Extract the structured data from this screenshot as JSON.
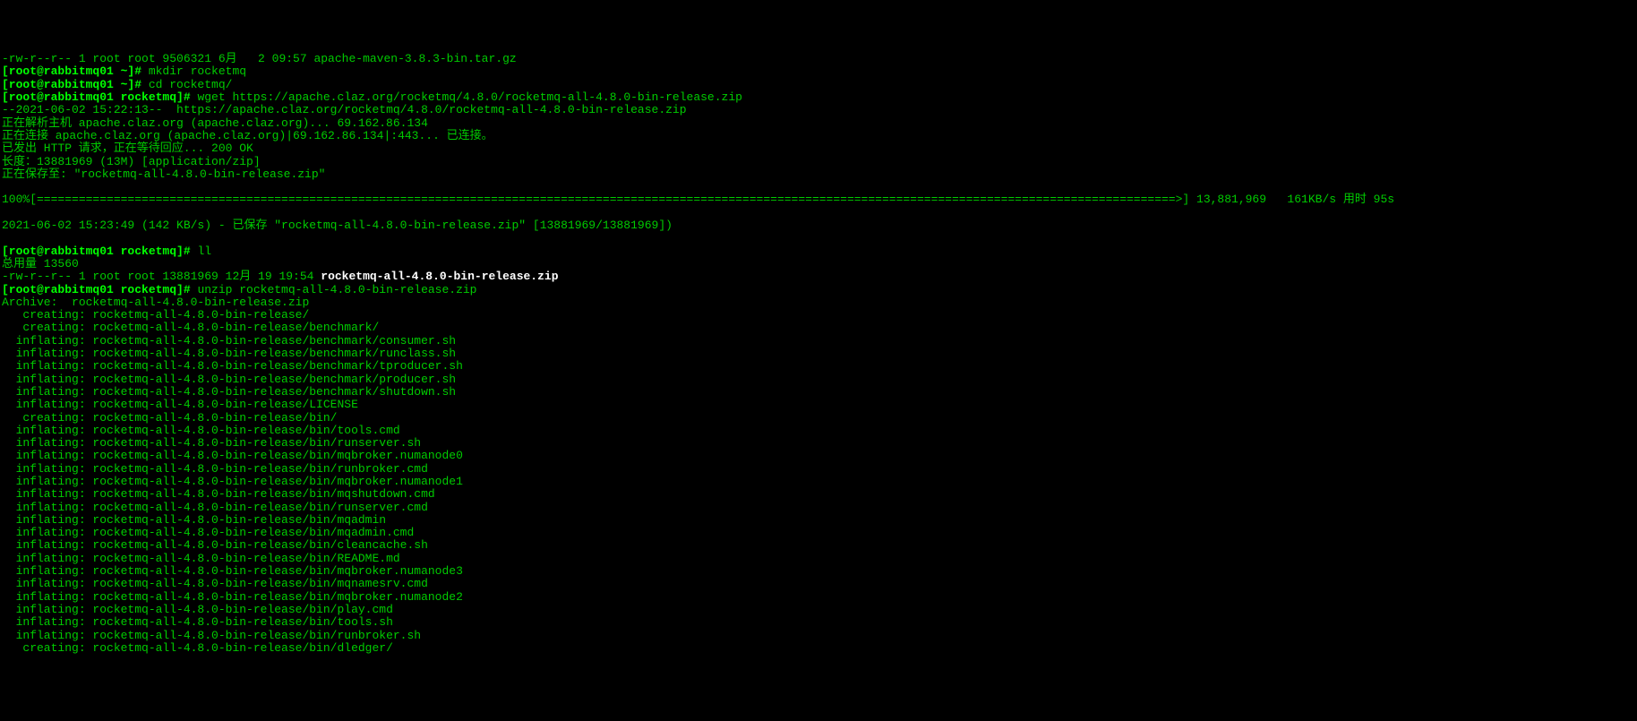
{
  "lines": [
    {
      "text": "-rw-r--r-- 1 root root 9506321 6月   2 09:57 apache-maven-3.8.3-bin.tar.gz",
      "class": "normal-green"
    },
    {
      "segments": [
        {
          "text": "[root@rabbitmq01 ~]# ",
          "class": "bright-green"
        },
        {
          "text": "mkdir rocketmq",
          "class": "normal-green"
        }
      ]
    },
    {
      "segments": [
        {
          "text": "[root@rabbitmq01 ~]# ",
          "class": "bright-green"
        },
        {
          "text": "cd rocketmq/",
          "class": "normal-green"
        }
      ]
    },
    {
      "segments": [
        {
          "text": "[root@rabbitmq01 rocketmq]# ",
          "class": "bright-green"
        },
        {
          "text": "wget https://apache.claz.org/rocketmq/4.8.0/rocketmq-all-4.8.0-bin-release.zip",
          "class": "normal-green"
        }
      ]
    },
    {
      "text": "--2021-06-02 15:22:13--  https://apache.claz.org/rocketmq/4.8.0/rocketmq-all-4.8.0-bin-release.zip",
      "class": "normal-green"
    },
    {
      "text": "正在解析主机 apache.claz.org (apache.claz.org)... 69.162.86.134",
      "class": "normal-green"
    },
    {
      "text": "正在连接 apache.claz.org (apache.claz.org)|69.162.86.134|:443... 已连接。",
      "class": "normal-green"
    },
    {
      "text": "已发出 HTTP 请求，正在等待回应... 200 OK",
      "class": "normal-green"
    },
    {
      "text": "长度：13881969 (13M) [application/zip]",
      "class": "normal-green"
    },
    {
      "text": "正在保存至: \"rocketmq-all-4.8.0-bin-release.zip\"",
      "class": "normal-green"
    },
    {
      "text": " ",
      "class": "normal-green"
    },
    {
      "text": "100%[===================================================================================================================================================================>] 13,881,969   161KB/s 用时 95s   ",
      "class": "normal-green"
    },
    {
      "text": " ",
      "class": "normal-green"
    },
    {
      "text": "2021-06-02 15:23:49 (142 KB/s) - 已保存 \"rocketmq-all-4.8.0-bin-release.zip\" [13881969/13881969])",
      "class": "normal-green"
    },
    {
      "text": " ",
      "class": "normal-green"
    },
    {
      "segments": [
        {
          "text": "[root@rabbitmq01 rocketmq]# ",
          "class": "bright-green"
        },
        {
          "text": "ll",
          "class": "normal-green"
        }
      ]
    },
    {
      "text": "总用量 13560",
      "class": "normal-green"
    },
    {
      "segments": [
        {
          "text": "-rw-r--r-- 1 root root 13881969 12月 19 19:54 ",
          "class": "normal-green"
        },
        {
          "text": "rocketmq-all-4.8.0-bin-release.zip",
          "class": "white-bold"
        }
      ]
    },
    {
      "segments": [
        {
          "text": "[root@rabbitmq01 rocketmq]# ",
          "class": "bright-green"
        },
        {
          "text": "unzip rocketmq-all-4.8.0-bin-release.zip",
          "class": "normal-green"
        }
      ]
    },
    {
      "text": "Archive:  rocketmq-all-4.8.0-bin-release.zip",
      "class": "normal-green"
    },
    {
      "text": "   creating: rocketmq-all-4.8.0-bin-release/",
      "class": "normal-green"
    },
    {
      "text": "   creating: rocketmq-all-4.8.0-bin-release/benchmark/",
      "class": "normal-green"
    },
    {
      "text": "  inflating: rocketmq-all-4.8.0-bin-release/benchmark/consumer.sh",
      "class": "normal-green"
    },
    {
      "text": "  inflating: rocketmq-all-4.8.0-bin-release/benchmark/runclass.sh",
      "class": "normal-green"
    },
    {
      "text": "  inflating: rocketmq-all-4.8.0-bin-release/benchmark/tproducer.sh",
      "class": "normal-green"
    },
    {
      "text": "  inflating: rocketmq-all-4.8.0-bin-release/benchmark/producer.sh",
      "class": "normal-green"
    },
    {
      "text": "  inflating: rocketmq-all-4.8.0-bin-release/benchmark/shutdown.sh",
      "class": "normal-green"
    },
    {
      "text": "  inflating: rocketmq-all-4.8.0-bin-release/LICENSE",
      "class": "normal-green"
    },
    {
      "text": "   creating: rocketmq-all-4.8.0-bin-release/bin/",
      "class": "normal-green"
    },
    {
      "text": "  inflating: rocketmq-all-4.8.0-bin-release/bin/tools.cmd",
      "class": "normal-green"
    },
    {
      "text": "  inflating: rocketmq-all-4.8.0-bin-release/bin/runserver.sh",
      "class": "normal-green"
    },
    {
      "text": "  inflating: rocketmq-all-4.8.0-bin-release/bin/mqbroker.numanode0",
      "class": "normal-green"
    },
    {
      "text": "  inflating: rocketmq-all-4.8.0-bin-release/bin/runbroker.cmd",
      "class": "normal-green"
    },
    {
      "text": "  inflating: rocketmq-all-4.8.0-bin-release/bin/mqbroker.numanode1",
      "class": "normal-green"
    },
    {
      "text": "  inflating: rocketmq-all-4.8.0-bin-release/bin/mqshutdown.cmd",
      "class": "normal-green"
    },
    {
      "text": "  inflating: rocketmq-all-4.8.0-bin-release/bin/runserver.cmd",
      "class": "normal-green"
    },
    {
      "text": "  inflating: rocketmq-all-4.8.0-bin-release/bin/mqadmin",
      "class": "normal-green"
    },
    {
      "text": "  inflating: rocketmq-all-4.8.0-bin-release/bin/mqadmin.cmd",
      "class": "normal-green"
    },
    {
      "text": "  inflating: rocketmq-all-4.8.0-bin-release/bin/cleancache.sh",
      "class": "normal-green"
    },
    {
      "text": "  inflating: rocketmq-all-4.8.0-bin-release/bin/README.md",
      "class": "normal-green"
    },
    {
      "text": "  inflating: rocketmq-all-4.8.0-bin-release/bin/mqbroker.numanode3",
      "class": "normal-green"
    },
    {
      "text": "  inflating: rocketmq-all-4.8.0-bin-release/bin/mqnamesrv.cmd",
      "class": "normal-green"
    },
    {
      "text": "  inflating: rocketmq-all-4.8.0-bin-release/bin/mqbroker.numanode2",
      "class": "normal-green"
    },
    {
      "text": "  inflating: rocketmq-all-4.8.0-bin-release/bin/play.cmd",
      "class": "normal-green"
    },
    {
      "text": "  inflating: rocketmq-all-4.8.0-bin-release/bin/tools.sh",
      "class": "normal-green"
    },
    {
      "text": "  inflating: rocketmq-all-4.8.0-bin-release/bin/runbroker.sh",
      "class": "normal-green"
    },
    {
      "text": "   creating: rocketmq-all-4.8.0-bin-release/bin/dledger/",
      "class": "normal-green"
    }
  ]
}
